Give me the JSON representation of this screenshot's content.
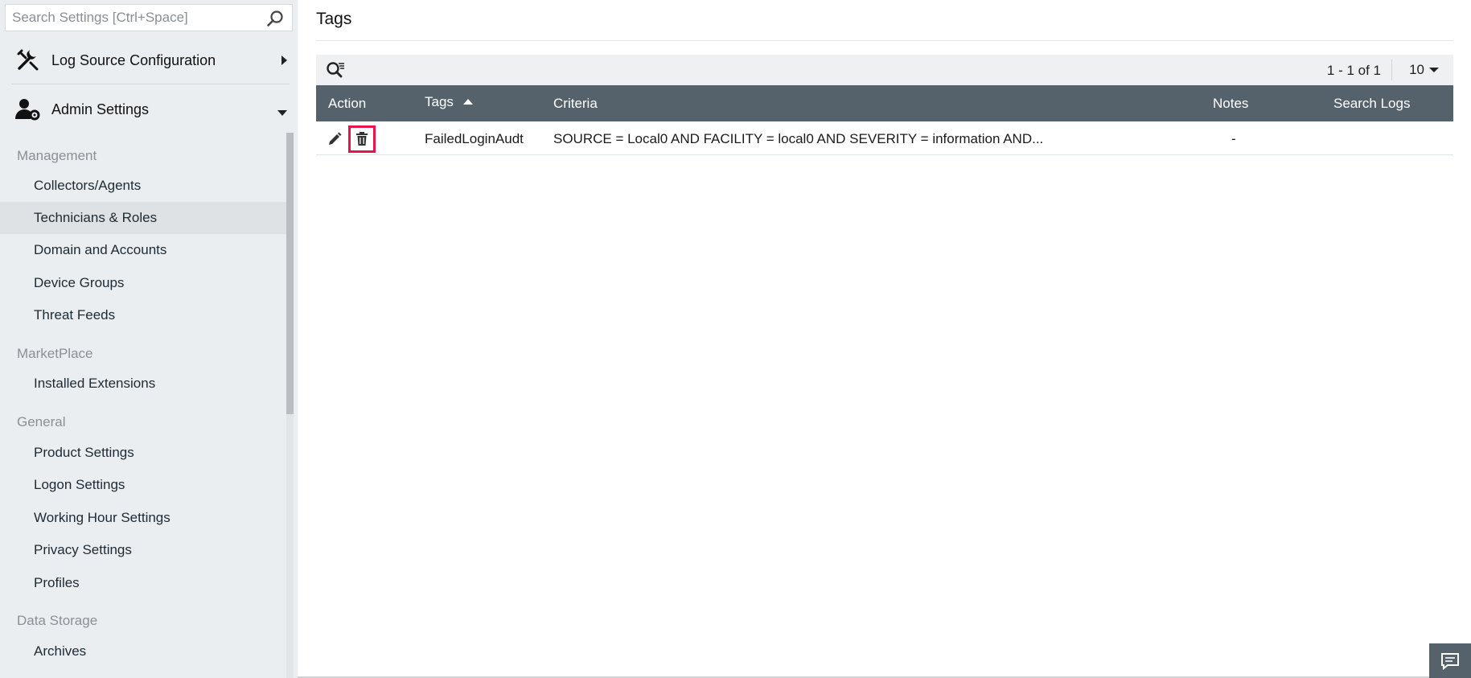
{
  "sidebar": {
    "search_placeholder": "Search Settings [Ctrl+Space]",
    "top_items": [
      {
        "label": "Log Source Configuration",
        "icon": "tools-icon",
        "expanded": false
      },
      {
        "label": "Admin Settings",
        "icon": "user-gear-icon",
        "expanded": true
      }
    ],
    "sections": [
      {
        "heading": "Management",
        "items": [
          "Collectors/Agents",
          "Technicians & Roles",
          "Domain and Accounts",
          "Device Groups",
          "Threat Feeds"
        ]
      },
      {
        "heading": "MarketPlace",
        "items": [
          "Installed Extensions"
        ]
      },
      {
        "heading": "General",
        "items": [
          "Product Settings",
          "Logon Settings",
          "Working Hour Settings",
          "Privacy Settings",
          "Profiles"
        ]
      },
      {
        "heading": "Data Storage",
        "items": [
          "Archives"
        ]
      }
    ],
    "active_item": "Technicians & Roles"
  },
  "main": {
    "title": "Tags",
    "pager": {
      "range": "1 - 1 of 1",
      "per_page": "10"
    },
    "table": {
      "columns": [
        "Action",
        "Tags",
        "Criteria",
        "Notes",
        "Search Logs"
      ],
      "sorted_column": "Tags",
      "sort_direction": "ascending",
      "rows": [
        {
          "tag": "FailedLoginAudt",
          "criteria": "SOURCE = Local0 AND FACILITY = local0 AND SEVERITY = information AND...",
          "notes": "-",
          "search_logs": ""
        }
      ]
    }
  },
  "colors": {
    "header_bg": "#55626b",
    "highlight": "#e8134a",
    "sidebar_bg": "#ebeef0"
  }
}
